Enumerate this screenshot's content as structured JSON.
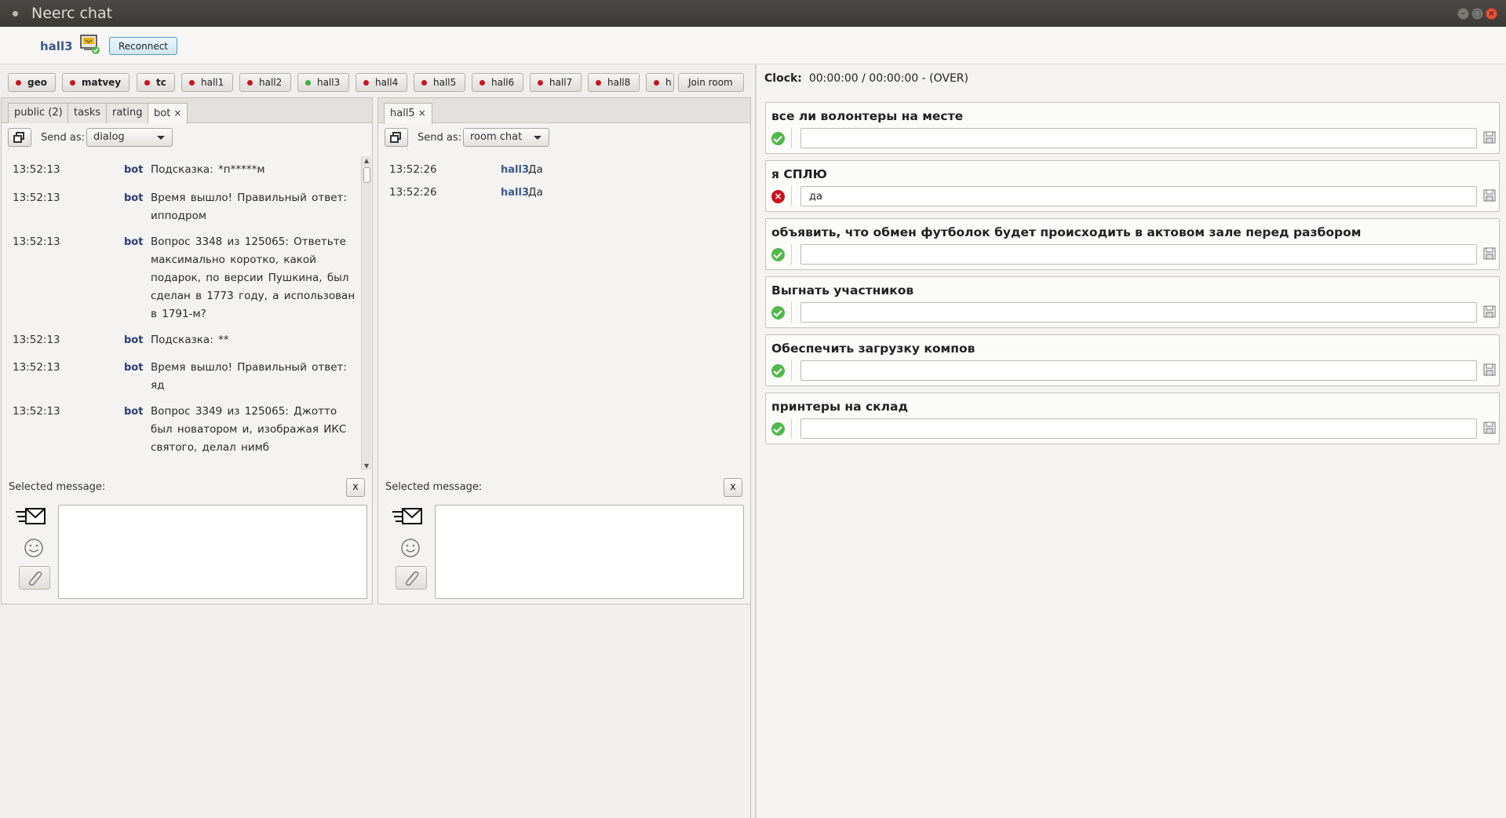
{
  "window": {
    "title": "Neerc chat"
  },
  "header": {
    "username": "hall3",
    "reconnect_label": "Reconnect"
  },
  "rooms": [
    {
      "label": "geo",
      "status": "red",
      "bold": true
    },
    {
      "label": "matvey",
      "status": "red",
      "bold": true
    },
    {
      "label": "tc",
      "status": "red",
      "bold": true
    },
    {
      "label": "hall1",
      "status": "red",
      "bold": false
    },
    {
      "label": "hall2",
      "status": "red",
      "bold": false
    },
    {
      "label": "hall3",
      "status": "green",
      "bold": false
    },
    {
      "label": "hall4",
      "status": "red",
      "bold": false
    },
    {
      "label": "hall5",
      "status": "red",
      "bold": false
    },
    {
      "label": "hall6",
      "status": "red",
      "bold": false
    },
    {
      "label": "hall7",
      "status": "red",
      "bold": false
    },
    {
      "label": "hall8",
      "status": "red",
      "bold": false
    },
    {
      "label": "h",
      "status": "red",
      "bold": false
    }
  ],
  "join_room_label": "Join room",
  "left_panel": {
    "tabs": [
      "public (2)",
      "tasks",
      "rating",
      "bot"
    ],
    "close_glyph": "×",
    "send_as_label": "Send as:",
    "send_as_value": "dialog",
    "messages": [
      {
        "time": "13:52:13",
        "author": "bot",
        "text": "Подсказка: *п*****м"
      },
      {
        "time": "13:52:13",
        "author": "bot",
        "text": "Время вышло! Правильный ответ: ипподром"
      },
      {
        "time": "13:52:13",
        "author": "bot",
        "text": "Вопрос 3348 из 125065: Ответьте максимально коротко, какой подарок, по версии Пушкина, был сделан в 1773 году, а использован в 1791-м?"
      },
      {
        "time": "13:52:13",
        "author": "bot",
        "text": "Подсказка: **"
      },
      {
        "time": "13:52:13",
        "author": "bot",
        "text": "Время вышло! Правильный ответ: яд"
      },
      {
        "time": "13:52:13",
        "author": "bot",
        "text": "Вопрос 3349 из 125065: Джотто был новатором и, изображая ИКС святого, делал нимб"
      }
    ],
    "selected_label": "Selected message:",
    "clear_label": "x"
  },
  "middle_panel": {
    "tabs": [
      "hall5"
    ],
    "close_glyph": "×",
    "send_as_label": "Send as:",
    "send_as_value": "room chat",
    "messages": [
      {
        "time": "13:52:26",
        "author": "hall3",
        "text": "Да"
      },
      {
        "time": "13:52:26",
        "author": "hall3",
        "text": "Да"
      }
    ],
    "selected_label": "Selected message:",
    "clear_label": "x"
  },
  "tasks_pane": {
    "clock_label": "Clock:",
    "clock_value": "00:00:00 / 00:00:00 - (OVER)",
    "tasks": [
      {
        "title": "все ли волонтеры на месте",
        "status": "ok",
        "value": ""
      },
      {
        "title": "я СПЛЮ",
        "status": "fail",
        "value": "да"
      },
      {
        "title": "объявить, что обмен футболок будет происходить в актовом зале перед разбором",
        "status": "ok",
        "value": ""
      },
      {
        "title": "Выгнать участников",
        "status": "ok",
        "value": ""
      },
      {
        "title": "Обеспечить загрузку компов",
        "status": "ok",
        "value": ""
      },
      {
        "title": "принтеры на склад",
        "status": "ok",
        "value": ""
      }
    ]
  },
  "colors": {
    "accent": "#3a5a8c",
    "ok": "#52b84c",
    "fail": "#c8141f",
    "titlebar": "#3c3b37"
  }
}
